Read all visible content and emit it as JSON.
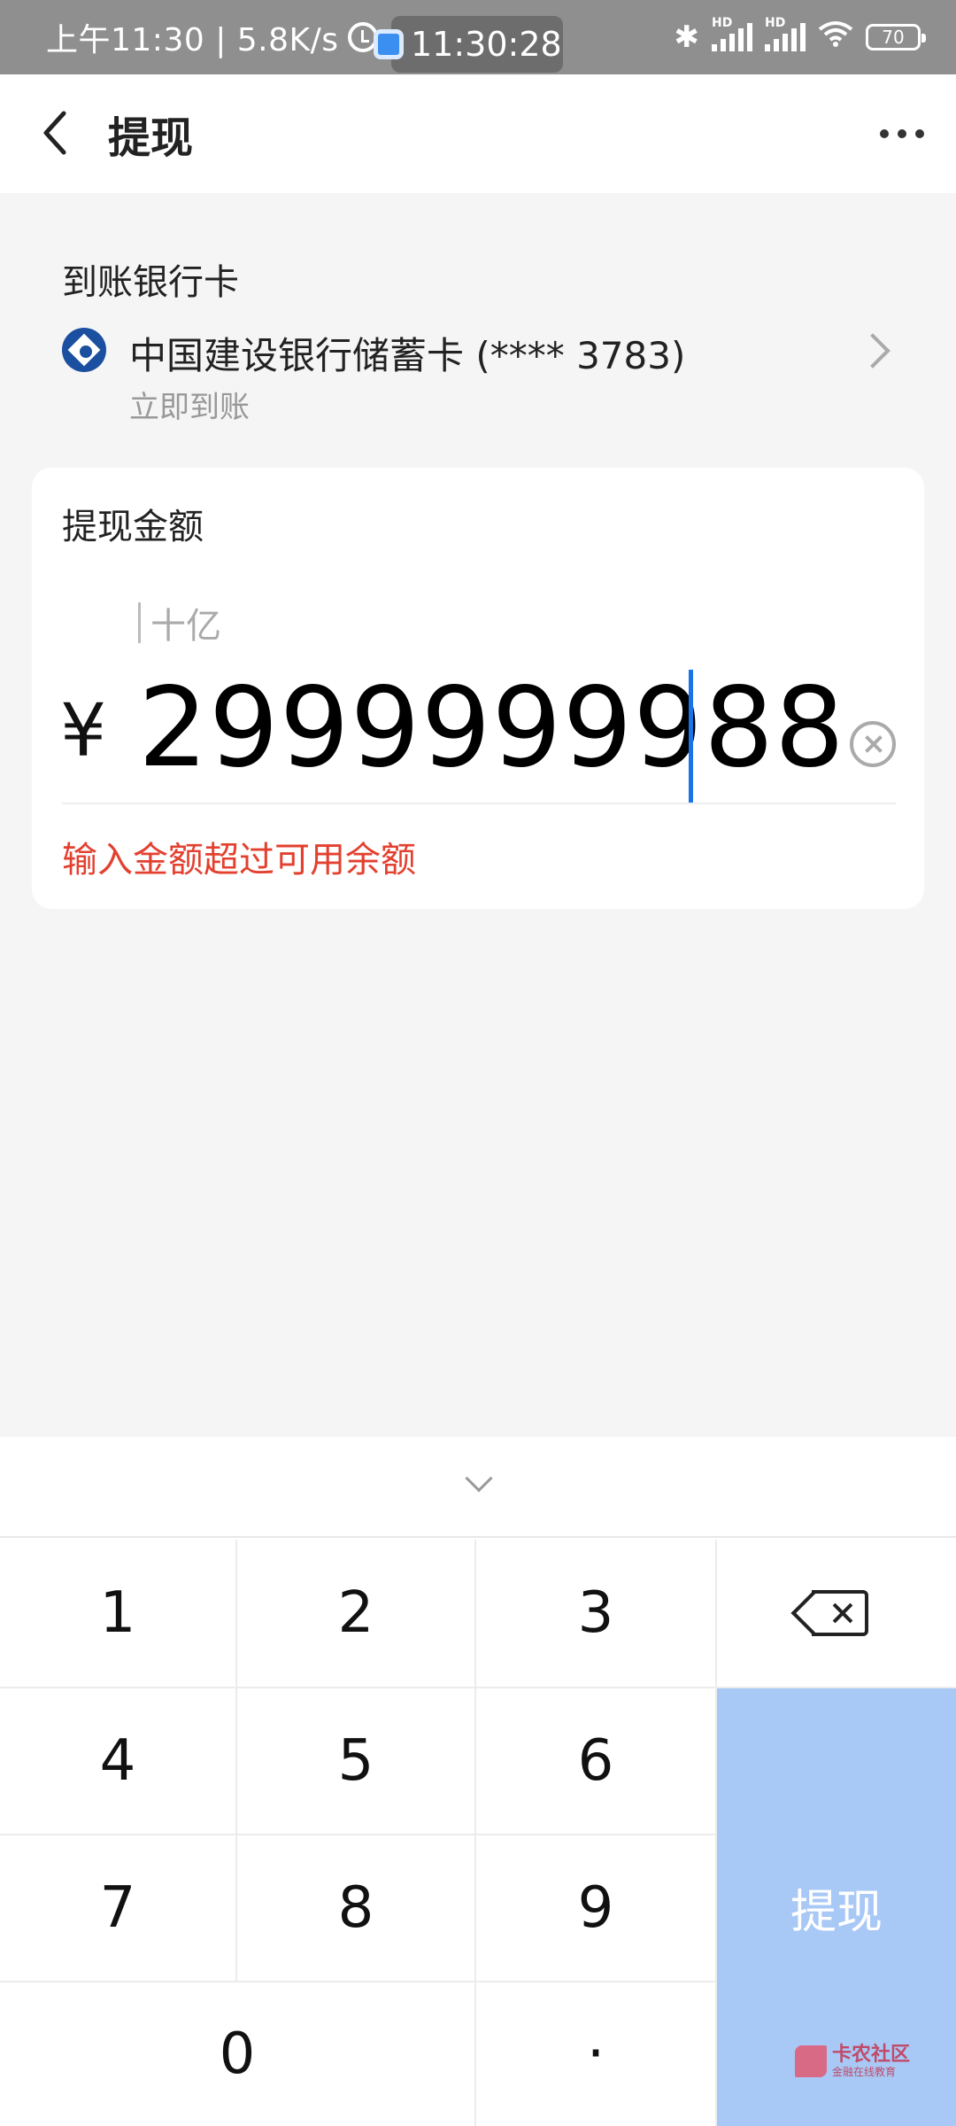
{
  "status_bar": {
    "left_text": "上午11:30 | 5.8K/s",
    "clock": "11:30:28",
    "signal1_label": "HD",
    "signal2_label": "HD",
    "battery": "70"
  },
  "header": {
    "title": "提现"
  },
  "bank": {
    "label": "到账银行卡",
    "name": "中国建设银行储蓄卡 (**** 3783)",
    "sub": "立即到账"
  },
  "amount_card": {
    "label": "提现金额",
    "unit_hint": "十亿",
    "currency": "¥",
    "value": "2999999988",
    "error": "输入金额超过可用余额"
  },
  "keyboard": {
    "keys": {
      "k1": "1",
      "k2": "2",
      "k3": "3",
      "k4": "4",
      "k5": "5",
      "k6": "6",
      "k7": "7",
      "k8": "8",
      "k9": "9",
      "k0": "0",
      "dot": "·"
    },
    "submit_label": "提现"
  },
  "watermark": {
    "title": "卡农社区",
    "sub": "金融在线教育"
  }
}
